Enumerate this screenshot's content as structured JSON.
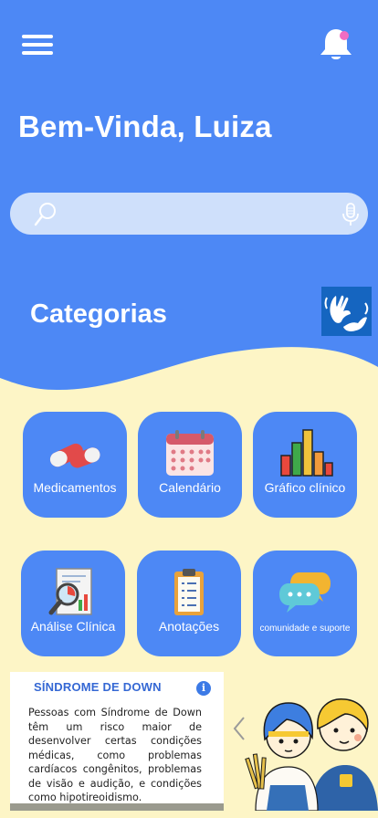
{
  "header": {
    "greeting": "Bem-Vinda, Luiza",
    "menu_icon": "hamburger-menu-icon",
    "notification_icon": "bell-icon",
    "notification_dot_color": "#f06dc2"
  },
  "search": {
    "placeholder": "",
    "search_icon": "search-icon",
    "mic_icon": "microphone-icon"
  },
  "categories": {
    "title": "Categorias",
    "accessibility_icon": "sign-language-icon",
    "items": [
      {
        "label": "Medicamentos",
        "icon": "pills-icon"
      },
      {
        "label": "Calendário",
        "icon": "calendar-icon"
      },
      {
        "label": "Gráfico clínico",
        "icon": "bar-chart-icon"
      },
      {
        "label": "Análise Clínica",
        "icon": "analysis-icon"
      },
      {
        "label": "Anotações",
        "icon": "clipboard-icon"
      },
      {
        "label": "comunidade e suporte",
        "icon": "chat-bubbles-icon"
      }
    ]
  },
  "info_card": {
    "title": "SÍNDROME DE DOWN",
    "text": "Pessoas com Síndrome de Down têm um risco maior de desenvolver certas condições médicas, como problemas cardíacos congênitos, problemas de visão e audição, e condições como hipotireoidismo."
  },
  "colors": {
    "primary_blue": "#4d88f5",
    "cream_background": "#fdf5c6",
    "search_background": "#cfe0fb"
  }
}
